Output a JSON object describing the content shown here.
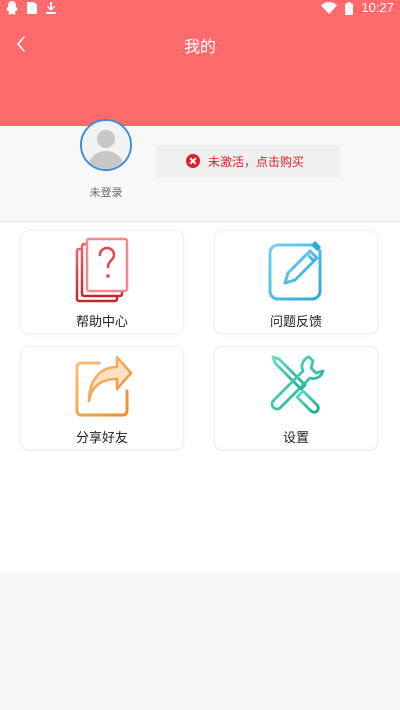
{
  "status_bar": {
    "time": "10:27",
    "icons": [
      "qq-icon",
      "sim-card-icon",
      "download-icon",
      "wifi-icon",
      "battery-icon"
    ]
  },
  "header": {
    "title": "我的",
    "back_icon": "chevron-left-icon",
    "background_color": "#fd6a6c"
  },
  "profile": {
    "avatar_icon": "default-user-avatar",
    "login_status": "未登录",
    "activation_text": "未激活，点击购买",
    "activation_icon": "close-circle-icon",
    "accent_color": "#d8232a"
  },
  "menu": [
    {
      "label": "帮助中心",
      "icon": "help-question-icon"
    },
    {
      "label": "问题反馈",
      "icon": "edit-feedback-icon"
    },
    {
      "label": "分享好友",
      "icon": "share-arrow-icon"
    },
    {
      "label": "设置",
      "icon": "tools-settings-icon"
    }
  ]
}
